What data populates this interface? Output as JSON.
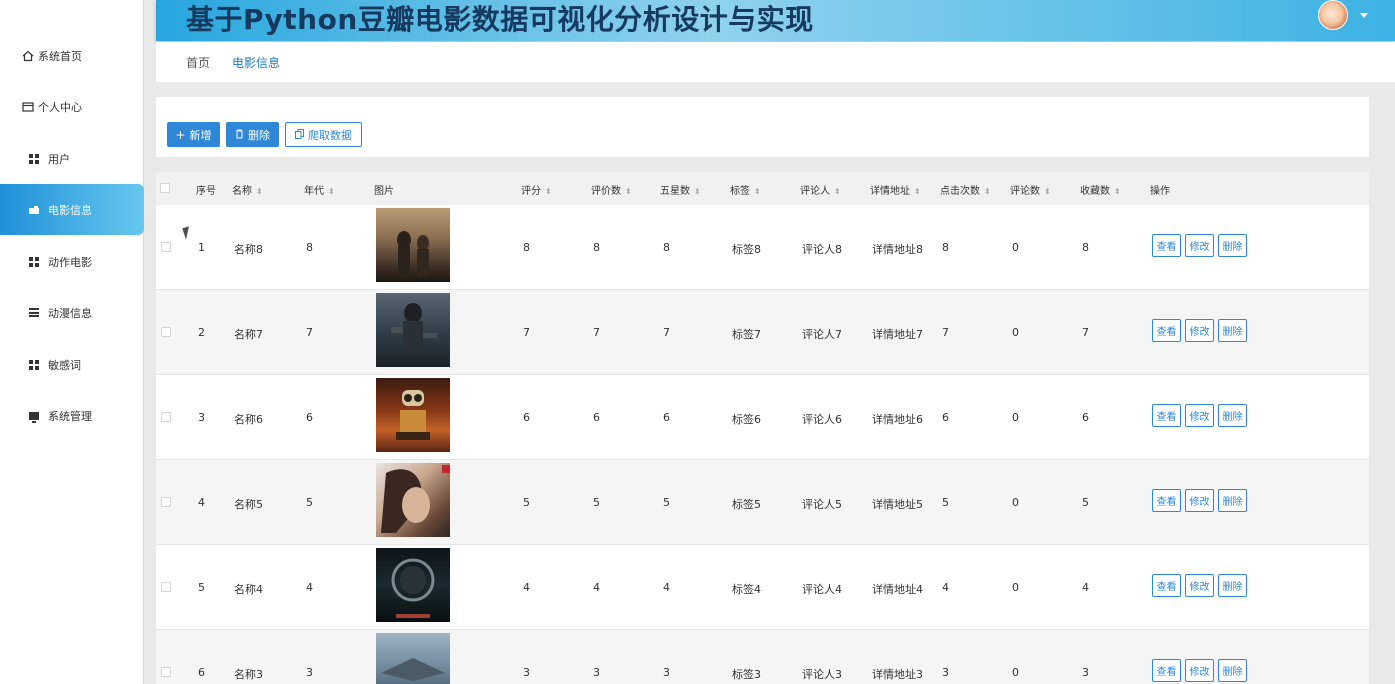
{
  "header": {
    "title": "基于Python豆瓣电影数据可视化分析设计与实现"
  },
  "sidebar": {
    "items": [
      {
        "label": "系统首页",
        "icon": "home-icon"
      },
      {
        "label": "个人中心",
        "icon": "window-icon"
      },
      {
        "label": "用户",
        "icon": "grid-icon"
      },
      {
        "label": "电影信息",
        "icon": "cloud-icon",
        "active": true
      },
      {
        "label": "动作电影",
        "icon": "grid-icon"
      },
      {
        "label": "动漫信息",
        "icon": "list-icon"
      },
      {
        "label": "敏感词",
        "icon": "grid-icon"
      },
      {
        "label": "系统管理",
        "icon": "monitor-icon"
      }
    ]
  },
  "breadcrumb": {
    "home": "首页",
    "current": "电影信息"
  },
  "toolbar": {
    "add_label": "新增",
    "delete_label": "删除",
    "crawl_label": "爬取数据"
  },
  "table": {
    "columns": [
      "序号",
      "名称",
      "年代",
      "图片",
      "评分",
      "评价数",
      "五星数",
      "标签",
      "评论人",
      "详情地址",
      "点击次数",
      "评论数",
      "收藏数",
      "操作"
    ],
    "actions": {
      "view": "查看",
      "edit": "修改",
      "delete": "删除"
    },
    "rows": [
      {
        "index": "1",
        "name": "名称8",
        "year": "8",
        "score": "8",
        "reviews": "8",
        "five_star": "8",
        "tag": "标签8",
        "reviewer": "评论人8",
        "detail": "详情地址8",
        "clicks": "8",
        "comments": "0",
        "favorites": "8"
      },
      {
        "index": "2",
        "name": "名称7",
        "year": "7",
        "score": "7",
        "reviews": "7",
        "five_star": "7",
        "tag": "标签7",
        "reviewer": "评论人7",
        "detail": "详情地址7",
        "clicks": "7",
        "comments": "0",
        "favorites": "7"
      },
      {
        "index": "3",
        "name": "名称6",
        "year": "6",
        "score": "6",
        "reviews": "6",
        "five_star": "6",
        "tag": "标签6",
        "reviewer": "评论人6",
        "detail": "详情地址6",
        "clicks": "6",
        "comments": "0",
        "favorites": "6"
      },
      {
        "index": "4",
        "name": "名称5",
        "year": "5",
        "score": "5",
        "reviews": "5",
        "five_star": "5",
        "tag": "标签5",
        "reviewer": "评论人5",
        "detail": "详情地址5",
        "clicks": "5",
        "comments": "0",
        "favorites": "5"
      },
      {
        "index": "5",
        "name": "名称4",
        "year": "4",
        "score": "4",
        "reviews": "4",
        "five_star": "4",
        "tag": "标签4",
        "reviewer": "评论人4",
        "detail": "详情地址4",
        "clicks": "4",
        "comments": "0",
        "favorites": "4"
      },
      {
        "index": "6",
        "name": "名称3",
        "year": "3",
        "score": "3",
        "reviews": "3",
        "five_star": "3",
        "tag": "标签3",
        "reviewer": "评论人3",
        "detail": "详情地址3",
        "clicks": "3",
        "comments": "0",
        "favorites": "3"
      }
    ]
  },
  "colors": {
    "accent": "#2f87d8",
    "header_gradient_start": "#27a6de",
    "sidebar_active": "#1f90d8"
  }
}
